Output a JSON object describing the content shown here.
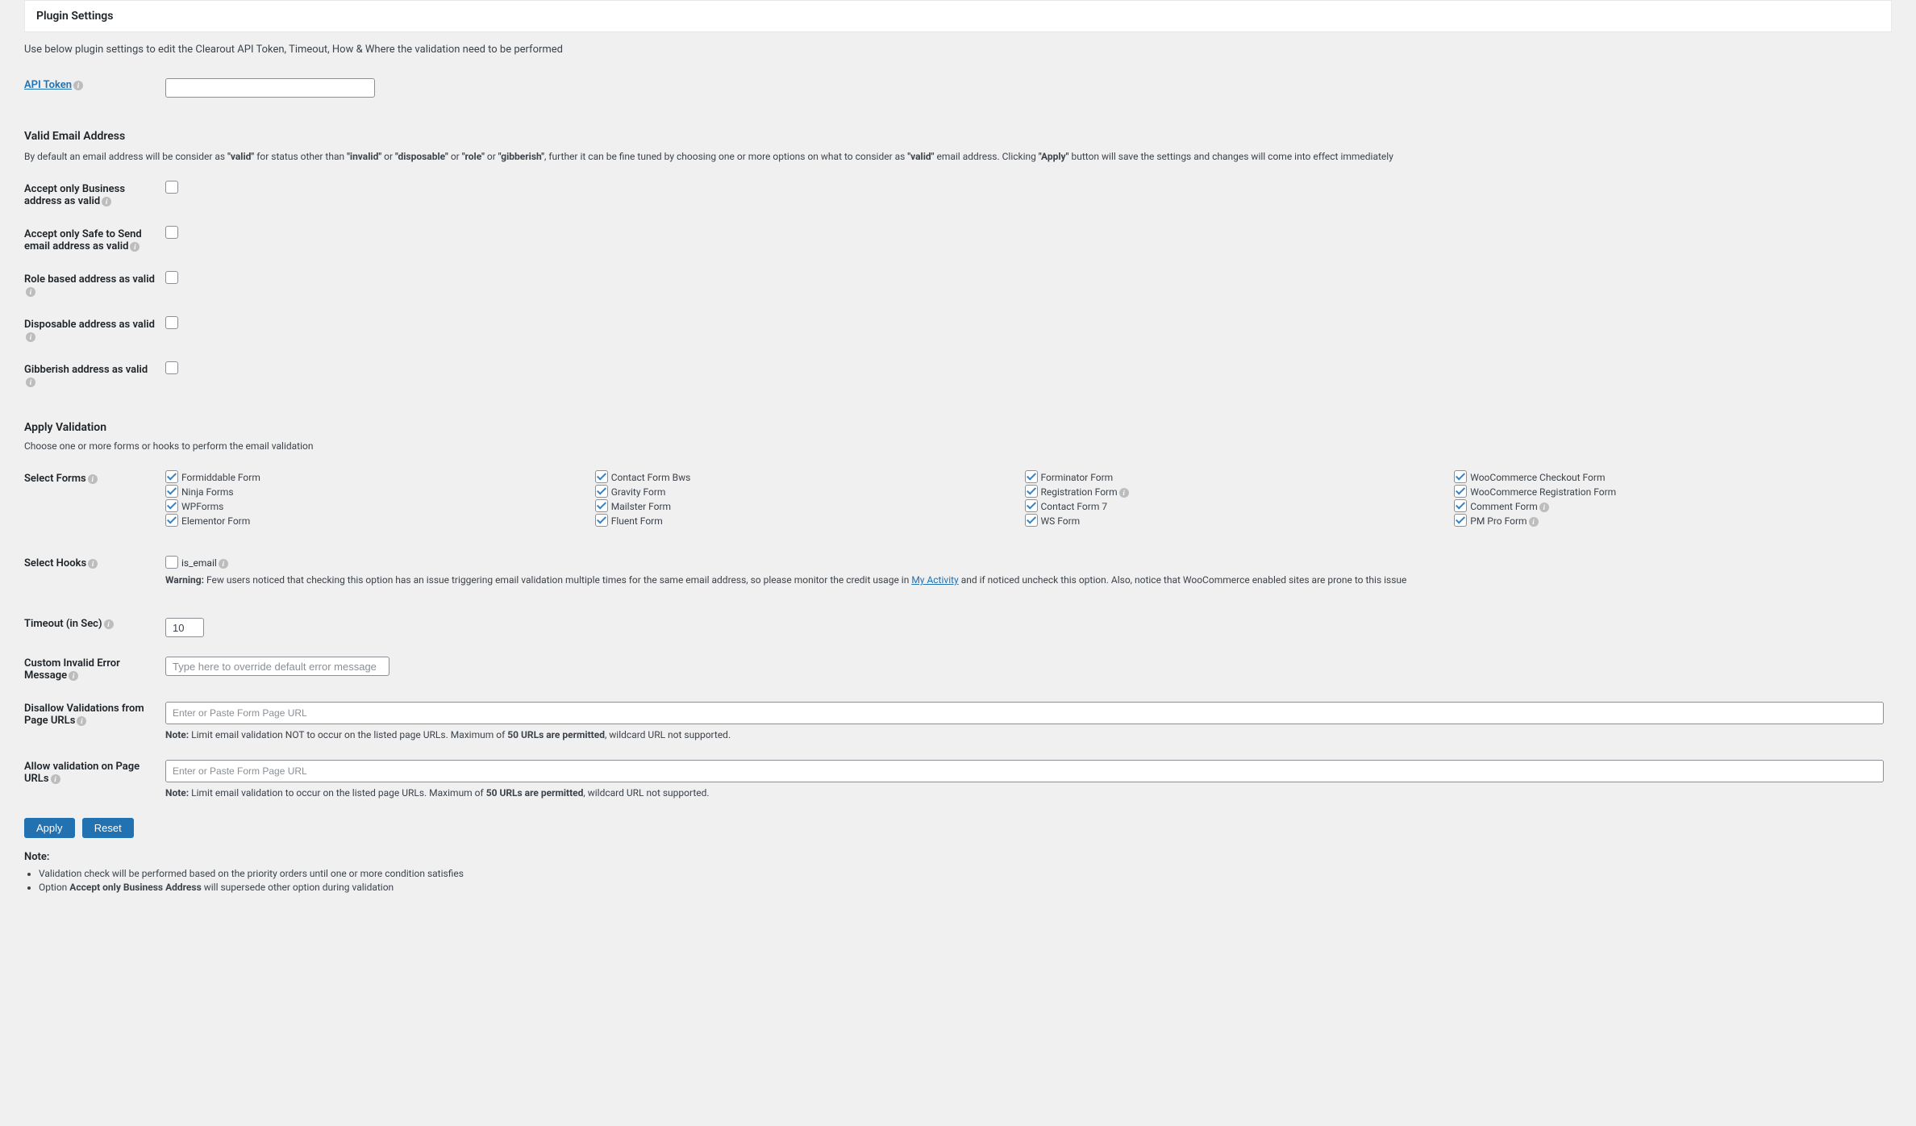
{
  "header": {
    "title": "Plugin Settings"
  },
  "intro": "Use below plugin settings to edit the Clearout API Token, Timeout, How & Where the validation need to be performed",
  "api_token": {
    "label": "API Token",
    "value": ""
  },
  "valid_email": {
    "heading": "Valid Email Address",
    "desc_pre": "By default an email address will be consider as ",
    "q_valid": "\"valid\"",
    "desc_status": " for status other than ",
    "q_invalid": "\"invalid\"",
    "or1": " or ",
    "q_disposable": "\"disposable\"",
    "or2": " or ",
    "q_role": "\"role\"",
    "or3": " or ",
    "q_gibberish": "\"gibberish\"",
    "desc_mid": ", further it can be fine tuned by choosing one or more options on what to consider as ",
    "q_valid2": "\"valid\"",
    "desc_click": " email address. Clicking ",
    "q_apply": "\"Apply\"",
    "desc_end": " button will save the settings and changes will come into effect immediately"
  },
  "options": {
    "business": "Accept only Business address as valid",
    "safe": "Accept only Safe to Send email address as valid",
    "role": "Role based address as valid",
    "disposable": "Disposable address as valid",
    "gibberish": "Gibberish address as valid"
  },
  "apply_validation": {
    "heading": "Apply Validation",
    "sub": "Choose one or more forms or hooks to perform the email validation"
  },
  "select_forms": {
    "label": "Select Forms",
    "col1": [
      "Formiddable Form",
      "Ninja Forms",
      "WPForms",
      "Elementor Form"
    ],
    "col2": [
      "Contact Form Bws",
      "Gravity Form",
      "Mailster Form",
      "Fluent Form"
    ],
    "col3": [
      "Forminator Form",
      "Registration Form",
      "Contact Form 7",
      "WS Form"
    ],
    "col3_info": [
      false,
      true,
      false,
      false
    ],
    "col4": [
      "WooCommerce Checkout Form",
      "WooCommerce Registration Form",
      "Comment Form",
      "PM Pro Form"
    ],
    "col4_info": [
      false,
      false,
      true,
      true
    ]
  },
  "select_hooks": {
    "label": "Select Hooks",
    "is_email": "is_email",
    "warn_label": "Warning:",
    "warn_pre": " Few users noticed that checking this option has an issue triggering email validation multiple times for the same email address, so please monitor the credit usage in ",
    "warn_link": "My Activity",
    "warn_post": " and if noticed uncheck this option. Also, notice that WooCommerce enabled sites are prone to this issue"
  },
  "timeout": {
    "label": "Timeout (in Sec)",
    "value": "10"
  },
  "error_msg": {
    "label": "Custom Invalid Error Message",
    "placeholder": "Type here to override default error message"
  },
  "disallow": {
    "label": "Disallow Validations from Page URLs",
    "placeholder": "Enter or Paste Form Page URL",
    "note_label": "Note:",
    "note_pre": " Limit email validation NOT to occur on the listed page URLs. Maximum of ",
    "note_bold": "50 URLs are permitted",
    "note_post": ", wildcard URL not supported."
  },
  "allow": {
    "label": "Allow validation on Page URLs",
    "placeholder": "Enter or Paste Form Page URL",
    "note_label": "Note:",
    "note_pre": " Limit email validation to occur on the listed page URLs. Maximum of ",
    "note_bold": "50 URLs are permitted",
    "note_post": ", wildcard URL not supported."
  },
  "buttons": {
    "apply": "Apply",
    "reset": "Reset"
  },
  "bottom": {
    "heading": "Note:",
    "item1": "Validation check will be performed based on the priority orders until one or more condition satisfies",
    "item2_pre": "Option ",
    "item2_bold": "Accept only Business Address",
    "item2_post": " will supersede other option during validation"
  }
}
